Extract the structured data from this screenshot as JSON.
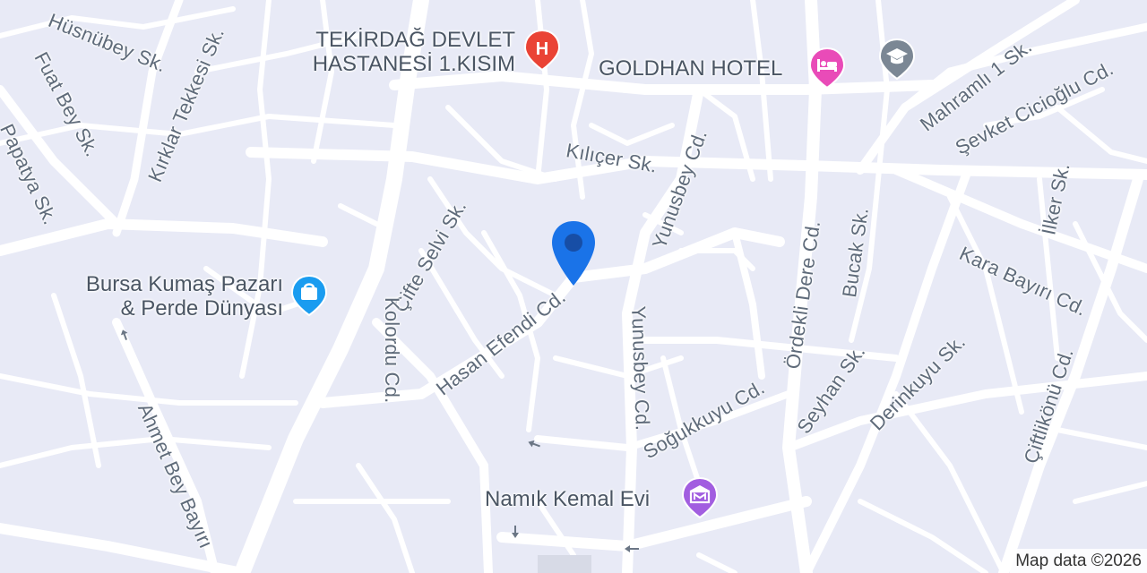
{
  "streets": {
    "husnubey": "Hüsnübey Sk.",
    "kirklar": "Kırklar Tekkesi Sk.",
    "fuatbey": "Fuat Bey Sk.",
    "papatya": "Papatya Sk.",
    "ciftesel": "Çifte Selvi Sk.",
    "kolordu": "Kolordu Cd.",
    "hasanefendi": "Hasan Efendi Cd.",
    "ahmetbey": "Ahmet Bey Bayırı",
    "kilicer": "Kılıçer Sk.",
    "yunusbey1": "Yunusbey Cd.",
    "yunusbey2": "Yunusbey Cd.",
    "sogukkuyu": "Soğukkuyu Cd.",
    "ordekli": "Ördekli Dere Cd.",
    "bucak": "Bucak Sk.",
    "seyhan": "Seyhan Sk.",
    "derinkuyu": "Derinkuyu Sk.",
    "mahramli": "Mahramlı 1 Sk.",
    "sevket": "Şevket Cicioğlu Cd.",
    "ilker": "İlker Sk.",
    "karabayiri": "Kara Bayırı Cd.",
    "ciftlikonu": "Çiftlikönü Cd."
  },
  "pois": {
    "hospital": {
      "line1": "TEKİRDAĞ DEVLET",
      "line2": "HASTANESİ 1.KISIM",
      "icon": "hospital-icon",
      "color": "#ea4335"
    },
    "hotel": {
      "label": "GOLDHAN HOTEL",
      "icon": "bed-icon",
      "color": "#e94bb8"
    },
    "school": {
      "icon": "school-icon",
      "color": "#7b8794"
    },
    "shop": {
      "line1": "Bursa Kumaş Pazarı",
      "line2": "& Perde Dünyası",
      "icon": "shopping-bag-icon",
      "color": "#1a9cf0"
    },
    "museum": {
      "label": "Namık Kemal Evi",
      "icon": "museum-icon",
      "color": "#a25ee0"
    }
  },
  "location_pin": {
    "icon": "location-pin-icon",
    "color": "#1a73e8"
  },
  "attribution": "Map data ©2026"
}
